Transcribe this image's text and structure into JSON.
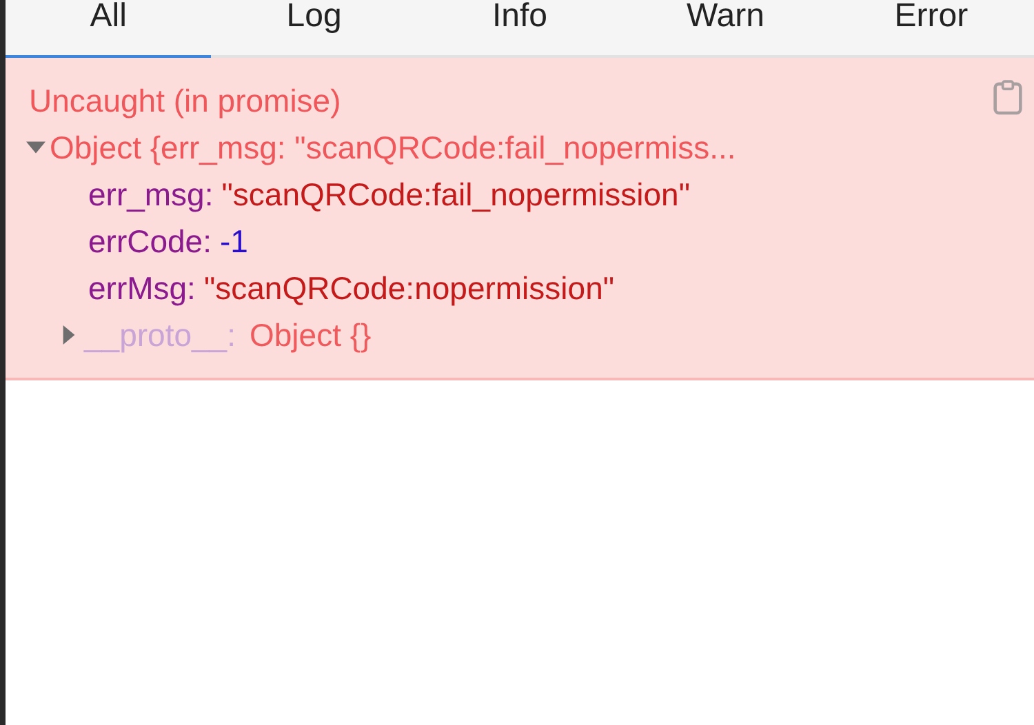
{
  "tabs": [
    {
      "label": "All",
      "selected": true
    },
    {
      "label": "Log",
      "selected": false
    },
    {
      "label": "Info",
      "selected": false
    },
    {
      "label": "Warn",
      "selected": false
    },
    {
      "label": "Error",
      "selected": false
    }
  ],
  "error": {
    "title": "Uncaught (in promise)",
    "object": {
      "label": "Object {err_msg: \"scanQRCode:fail_nopermiss...",
      "expanded": true,
      "children": [
        {
          "key": "err_msg:",
          "value": "\"scanQRCode:fail_nopermission\"",
          "kind": "string"
        },
        {
          "key": "errCode:",
          "value": "-1",
          "kind": "number"
        },
        {
          "key": "errMsg:",
          "value": "\"scanQRCode:nopermission\"",
          "kind": "string"
        },
        {
          "key": "__proto__:",
          "value": "Object {}",
          "kind": "prototype",
          "expanded": false
        }
      ]
    }
  }
}
